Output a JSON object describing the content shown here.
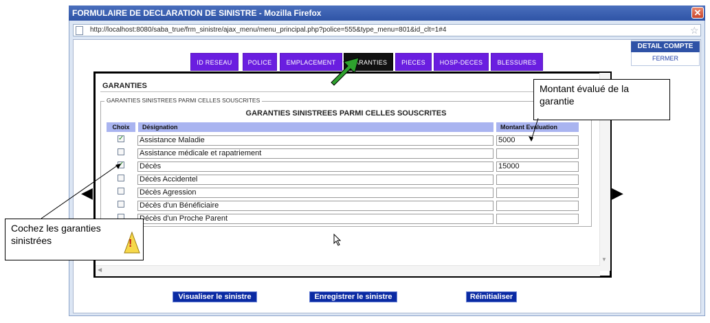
{
  "window": {
    "title": "FORMULAIRE DE DECLARATION DE SINISTRE - Mozilla Firefox",
    "close_glyph": "✕"
  },
  "address_bar": {
    "url": "http://localhost:8080/saba_true/frm_sinistre/ajax_menu/menu_principal.php?police=555&type_menu=801&id_clt=1#4"
  },
  "nav": {
    "tabs": [
      {
        "label": "ID RESEAU"
      },
      {
        "label": "POLICE"
      },
      {
        "label": "EMPLACEMENT"
      },
      {
        "label": "GARANTIES"
      },
      {
        "label": "PIECES"
      },
      {
        "label": "HOSP-DECES"
      },
      {
        "label": "BLESSURES"
      }
    ]
  },
  "detail_compte": {
    "title": "DETAIL COMPTE",
    "close_link": "FERMER"
  },
  "section": {
    "title": "GARANTIES",
    "legend": "GARANTIES SINISTREES PARMI CELLES SOUSCRITES",
    "heading": "GARANTIES SINISTREES PARMI CELLES SOUSCRITES"
  },
  "table": {
    "headers": {
      "choix": "Choix",
      "designation": "Désignation",
      "montant": "Montant Evaluation"
    },
    "rows": [
      {
        "designation": "Assistance Maladie",
        "montant": "5000",
        "checked": true
      },
      {
        "designation": "Assistance médicale et rapatriement",
        "montant": "",
        "checked": false
      },
      {
        "designation": "Décès",
        "montant": "15000",
        "checked": true
      },
      {
        "designation": "Décès Accidentel",
        "montant": "",
        "checked": false
      },
      {
        "designation": "Décès Agression",
        "montant": "",
        "checked": false
      },
      {
        "designation": "Décès d'un Bénéficiaire",
        "montant": "",
        "checked": false
      },
      {
        "designation": "Décès d'un Proche Parent",
        "montant": "",
        "checked": false
      }
    ]
  },
  "buttons": {
    "visualiser": "Visualiser le sinistre",
    "enregistrer": "Enregistrer le sinistre",
    "reinitialiser": "Réinitialiser"
  },
  "annotations": {
    "montant_callout": "Montant évalué de la garantie",
    "cochez_callout": "Cochez les garanties sinistrées",
    "warning_glyph": "!"
  },
  "arrows": {
    "prev": "◀",
    "next": "▶"
  },
  "colors": {
    "tab": "#6a1ee0",
    "tab_active": "#111111",
    "header": "#a9b4f0",
    "button": "#0a2aa3",
    "title_bar": "#2f54a6",
    "check": "#1e8a1e"
  }
}
